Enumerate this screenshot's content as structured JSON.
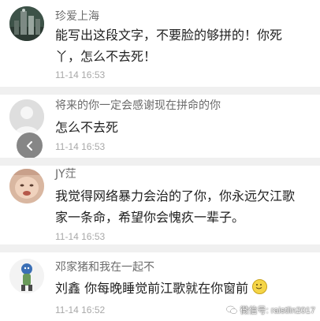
{
  "comments": [
    {
      "name": "珍爱上海",
      "text_line1": "能写出这段文字，不要脸的够拼的！你死",
      "text_line2": "丫，怎么不去死！",
      "time": "11-14 16:53",
      "avatar": "building-avatar"
    },
    {
      "name": "将来的你一定会感谢现在拼命的你",
      "text_line1": "怎么不去死",
      "time": "11-14 16:53",
      "avatar": "default-avatar"
    },
    {
      "name": "JY茳",
      "text_line1": "我觉得网络暴力会治的了你，你永远欠江歌",
      "text_line2": "家一条命，希望你会愧疚一辈子。",
      "time": "11-14 16:53",
      "avatar": "baby-avatar"
    },
    {
      "name": "邓家猪和我在一起不",
      "text_line1": "刘鑫 你每晚睡觉前江歌就在你窗前",
      "time": "11-14 16:52",
      "avatar": "character-avatar",
      "emoji": "smile-emoji"
    }
  ],
  "back_button": {
    "icon": "chevron-left-icon"
  },
  "watermark": {
    "text": "微信号: raistlin2017",
    "icon": "wechat-icon"
  },
  "colors": {
    "background": "#f0f0f0",
    "card": "#ffffff",
    "name": "#6b6b6b",
    "time": "#a8a8a8"
  }
}
